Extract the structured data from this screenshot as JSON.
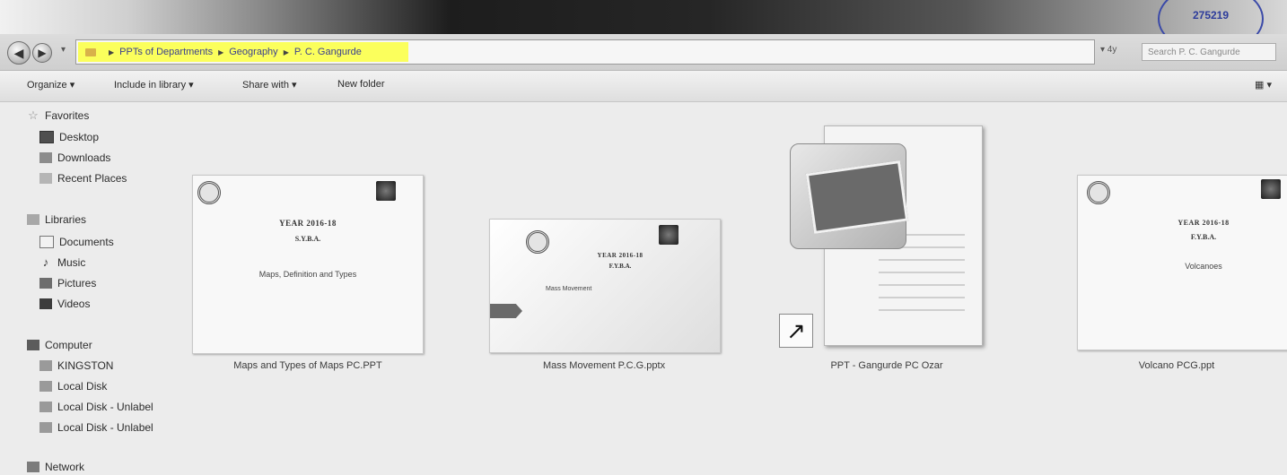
{
  "stamp_text": "275219",
  "nav": {
    "back_icon": "back-arrow-icon",
    "forward_icon": "forward-arrow-icon",
    "dropdown": "▾"
  },
  "address": {
    "crumbs": [
      "PPTs of Departments",
      "Geography",
      "P. C. Gangurde"
    ],
    "refresh": "▾ 4y",
    "search_placeholder": "Search P. C. Gangurde"
  },
  "toolbar": {
    "organize": "Organize ▾",
    "include_in_library": "Include in library ▾",
    "share_with": "Share with ▾",
    "new_folder": "New folder"
  },
  "sidebar": {
    "favorites": "Favorites",
    "desktop": "Desktop",
    "downloads": "Downloads",
    "recent_places": "Recent Places",
    "libraries": "Libraries",
    "documents": "Documents",
    "music": "Music",
    "pictures": "Pictures",
    "videos": "Videos",
    "computer": "Computer",
    "kingston": "KINGSTON",
    "local_disk": "Local Disk",
    "local_disk_unlabeled_1": "Local Disk - Unlabel",
    "local_disk_unlabeled_2": "Local Disk - Unlabel",
    "network": "Network"
  },
  "files": [
    {
      "name": "Maps and Types of Maps PC.PPT",
      "thumb_year": "YEAR 2016-18",
      "thumb_class": "S.Y.B.A.",
      "thumb_title": "Maps, Definition and Types"
    },
    {
      "name": "Mass Movement P.C.G.pptx",
      "thumb_year": "YEAR 2016-18",
      "thumb_class": "F.Y.B.A.",
      "thumb_title": "Mass Movement"
    },
    {
      "name": "PPT - Gangurde PC Ozar"
    },
    {
      "name": "Volcano PCG.ppt",
      "thumb_year": "YEAR 2016-18",
      "thumb_class": "F.Y.B.A.",
      "thumb_title": "Volcanoes"
    }
  ],
  "colors": {
    "breadcrumb_highlight": "#fbff5c",
    "stamp": "#3b4aa8"
  }
}
